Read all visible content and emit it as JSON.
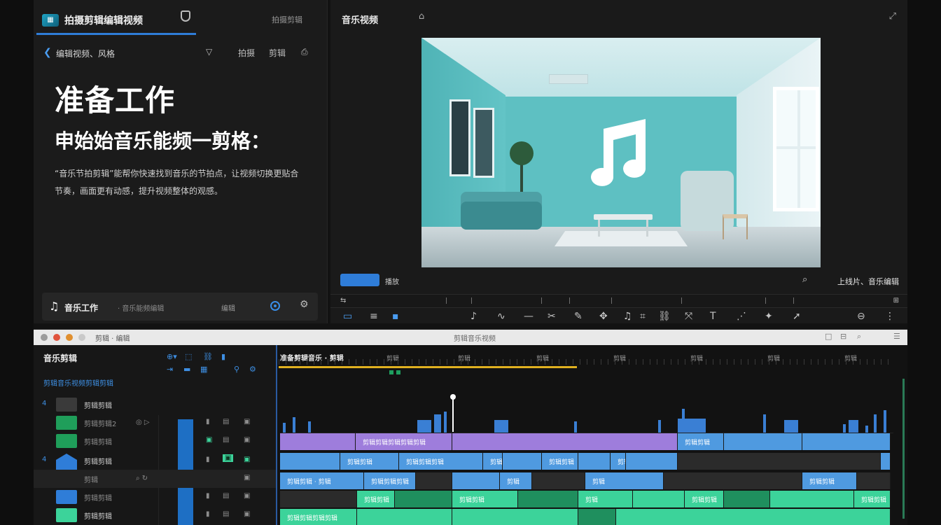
{
  "app": {
    "title": "拍摄剪辑编辑视频"
  },
  "header": {
    "right_label": "拍摄剪辑"
  },
  "nav": {
    "path": "编辑视频、风格",
    "icon_labels": [
      "拍摄",
      "剪辑"
    ]
  },
  "content": {
    "title": "准备工作",
    "subtitle": "申始始音乐能频一剪格：",
    "description": "“音乐节拍剪辑”能帮你快速找到音乐的节拍点，让视频切换更贴合节奏，画面更有动感，提升视频整体的观感。"
  },
  "track_bar": {
    "name": "音乐工作",
    "sub": "· 音乐能频编辑",
    "mid": "编辑"
  },
  "preview": {
    "title": "音乐视频",
    "mode_label": "播放",
    "right_label": "上线片、音乐编辑"
  },
  "timeline": {
    "window_left": "剪辑 · 编辑",
    "window_center": "剪辑音乐视频",
    "panel_title": "音乐剪辑",
    "panel_subtitle": "剪辑音乐视频剪辑剪辑",
    "sequence_tab": "准备剪辑音乐 · 剪辑",
    "time_labels": [
      "剪辑",
      "剪辑",
      "剪辑",
      "剪辑",
      "剪辑",
      "剪辑",
      "剪辑",
      "剪辑"
    ],
    "tracks": [
      {
        "num": "4",
        "label": "剪辑剪辑",
        "color": "#3a3a3a"
      },
      {
        "num": "",
        "label": "剪辑剪辑2",
        "color": "#1f9e5a"
      },
      {
        "num": "",
        "label": "剪辑剪辑",
        "color": "#1f9e5a"
      },
      {
        "num": "4",
        "label": "剪辑剪辑",
        "color": "#2f7dd8"
      },
      {
        "num": "",
        "label": "剪辑",
        "color": ""
      },
      {
        "num": "",
        "label": "剪辑剪辑",
        "color": "#2f7dd8"
      },
      {
        "num": "",
        "label": "剪辑剪辑",
        "color": "#3cd39a"
      }
    ],
    "clips": {
      "row1": [
        "剪辑剪辑剪辑剪辑剪辑",
        "剪辑剪辑"
      ],
      "row2": [
        "剪辑剪辑",
        "剪辑剪辑剪辑",
        "剪辑",
        "剪辑剪辑",
        "剪辑"
      ],
      "row3": [
        "剪辑剪辑 · 剪辑",
        "剪辑剪辑剪辑",
        "剪辑",
        "剪辑",
        "剪辑剪辑"
      ],
      "row4": [
        "剪辑剪辑",
        "剪辑剪辑",
        "剪辑",
        "剪辑剪辑",
        "剪辑剪辑"
      ],
      "row5": [
        "剪辑剪辑剪辑剪辑"
      ]
    }
  },
  "colors": {
    "accent": "#2f7dd8",
    "audio": "#3a7fd4",
    "purple_clip": "#9e7ddc",
    "green_clip": "#3cd39a",
    "room": "#6fcbcd"
  }
}
